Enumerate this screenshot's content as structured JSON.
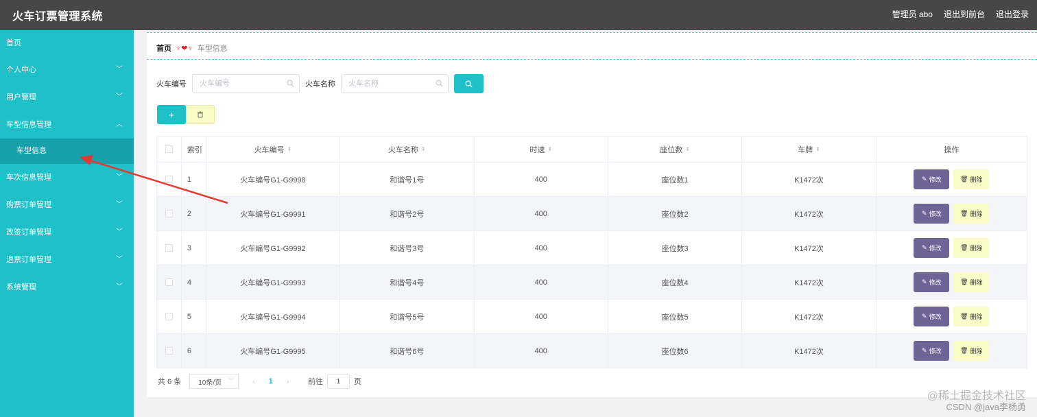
{
  "app": {
    "title": "火车订票管理系统"
  },
  "header": {
    "user": "管理员 abo",
    "to_front": "退出到前台",
    "logout": "退出登录"
  },
  "sidebar": {
    "items": [
      {
        "label": "首页",
        "expandable": false
      },
      {
        "label": "个人中心",
        "expandable": true
      },
      {
        "label": "用户管理",
        "expandable": true
      },
      {
        "label": "车型信息管理",
        "expandable": true,
        "expanded": true
      },
      {
        "label": "车型信息",
        "sub": true,
        "active": true
      },
      {
        "label": "车次信息管理",
        "expandable": true
      },
      {
        "label": "购票订单管理",
        "expandable": true
      },
      {
        "label": "改签订单管理",
        "expandable": true
      },
      {
        "label": "退票订单管理",
        "expandable": true
      },
      {
        "label": "系统管理",
        "expandable": true
      }
    ]
  },
  "breadcrumb": {
    "home": "首页",
    "separator": "♀❤♀",
    "current": "车型信息"
  },
  "search": {
    "field1_label": "火车编号",
    "field1_placeholder": "火车编号",
    "field2_label": "火车名称",
    "field2_placeholder": "火车名称"
  },
  "actions": {
    "add": "+"
  },
  "table": {
    "headers": [
      "索引",
      "火车编号",
      "火车名称",
      "时速",
      "座位数",
      "车牌",
      "操作"
    ],
    "rows": [
      {
        "index": "1",
        "code": "火车编号G1-G9998",
        "name": "和谐号1号",
        "speed": "400",
        "seats": "座位数1",
        "plate": "K1472次"
      },
      {
        "index": "2",
        "code": "火车编号G1-G9991",
        "name": "和谐号2号",
        "speed": "400",
        "seats": "座位数2",
        "plate": "K1472次"
      },
      {
        "index": "3",
        "code": "火车编号G1-G9992",
        "name": "和谐号3号",
        "speed": "400",
        "seats": "座位数3",
        "plate": "K1472次"
      },
      {
        "index": "4",
        "code": "火车编号G1-G9993",
        "name": "和谐号4号",
        "speed": "400",
        "seats": "座位数4",
        "plate": "K1472次"
      },
      {
        "index": "5",
        "code": "火车编号G1-G9994",
        "name": "和谐号5号",
        "speed": "400",
        "seats": "座位数5",
        "plate": "K1472次"
      },
      {
        "index": "6",
        "code": "火车编号G1-G9995",
        "name": "和谐号6号",
        "speed": "400",
        "seats": "座位数6",
        "plate": "K1472次"
      }
    ],
    "edit_label": "修改",
    "delete_label": "删除"
  },
  "pagination": {
    "total": "共 6 条",
    "page_size": "10条/页",
    "current_page": "1",
    "goto_label": "前往",
    "goto_value": "1",
    "page_suffix": "页"
  },
  "watermark": {
    "line1": "@稀土掘金技术社区",
    "line2": "CSDN @java李杨勇"
  },
  "colors": {
    "accent": "#20c0c8",
    "header": "#474747",
    "edit": "#6e6496",
    "delete": "#fbfbc7",
    "arrow": "#e53935"
  }
}
